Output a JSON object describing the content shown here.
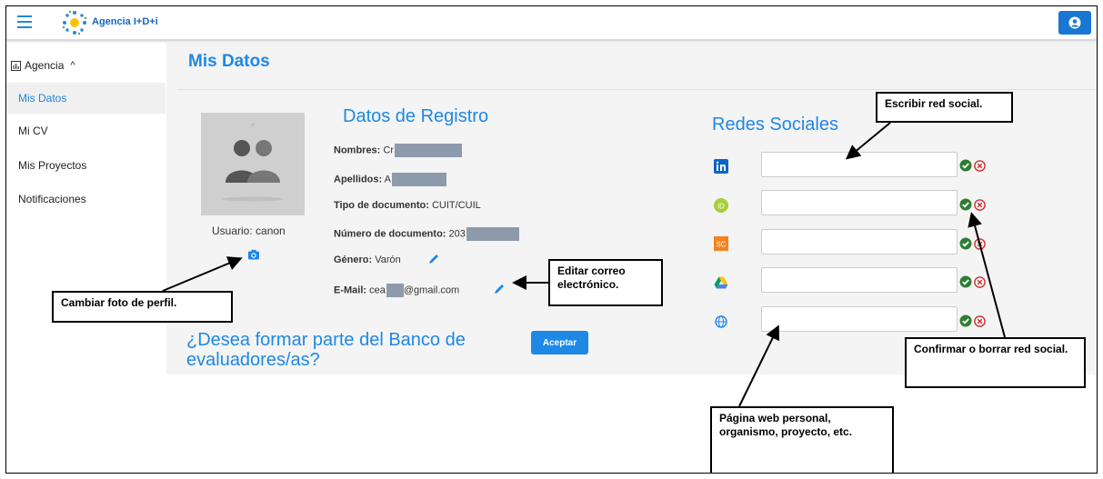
{
  "topbar": {
    "brand": "Agencia I+D+i"
  },
  "sidebar": {
    "section": "Agencia",
    "items": [
      {
        "label": "Mis Datos",
        "active": true
      },
      {
        "label": "Mi CV"
      },
      {
        "label": "Mis Proyectos"
      },
      {
        "label": "Notificaciones"
      }
    ]
  },
  "main": {
    "title": "Mis Datos",
    "username": "Usuario: canon",
    "registro": {
      "title": "Datos de Registro",
      "nombres_label": "Nombres:",
      "nombres_value": "Cr",
      "apellidos_label": "Apellidos:",
      "apellidos_value": "A",
      "tipo_label": "Tipo de documento:",
      "tipo_value": "CUIT/CUIL",
      "numero_label": "Número de documento:",
      "numero_value": "203",
      "genero_label": "Género:",
      "genero_value": "Varón",
      "email_label": "E-Mail:",
      "email_prefix": "cea",
      "email_suffix": "@gmail.com"
    },
    "banco_question": "¿Desea formar parte del Banco de evaluadores/as?",
    "accept_label": "Aceptar",
    "redes": {
      "title": "Redes Sociales",
      "items": [
        {
          "icon": "linkedin-icon",
          "value": ""
        },
        {
          "icon": "orcid-icon",
          "value": ""
        },
        {
          "icon": "scopus-icon",
          "value": ""
        },
        {
          "icon": "google-drive-icon",
          "value": ""
        },
        {
          "icon": "web-globe-icon",
          "value": ""
        }
      ]
    }
  },
  "callouts": {
    "escribir": "Escribir red social.",
    "editar": "Editar correo electrónico.",
    "cambiar": "Cambiar foto de perfil.",
    "confirmar": "Confirmar o borrar red social.",
    "pagina": "Página web personal, organismo, proyecto, etc."
  },
  "colors": {
    "accent": "#1e88e5",
    "ok": "#2e7d32",
    "delete": "#d32f2f"
  }
}
